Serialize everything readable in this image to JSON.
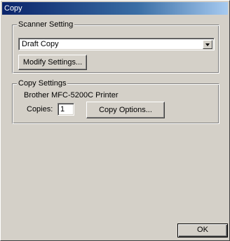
{
  "window": {
    "title": "Copy"
  },
  "scanner_setting": {
    "group_label": "Scanner Setting",
    "selected_value": "Draft Copy",
    "modify_button_label": "Modify Settings..."
  },
  "copy_settings": {
    "group_label": "Copy Settings",
    "printer_name": "Brother MFC-5200C Printer",
    "copies_label": "Copies:",
    "copies_value": "1",
    "options_button_label": "Copy Options..."
  },
  "footer": {
    "ok_label": "OK"
  },
  "colors": {
    "titlebar_start": "#0a246a",
    "face": "#d4d0c8"
  },
  "icons": {
    "dropdown": "chevron-down-icon"
  }
}
